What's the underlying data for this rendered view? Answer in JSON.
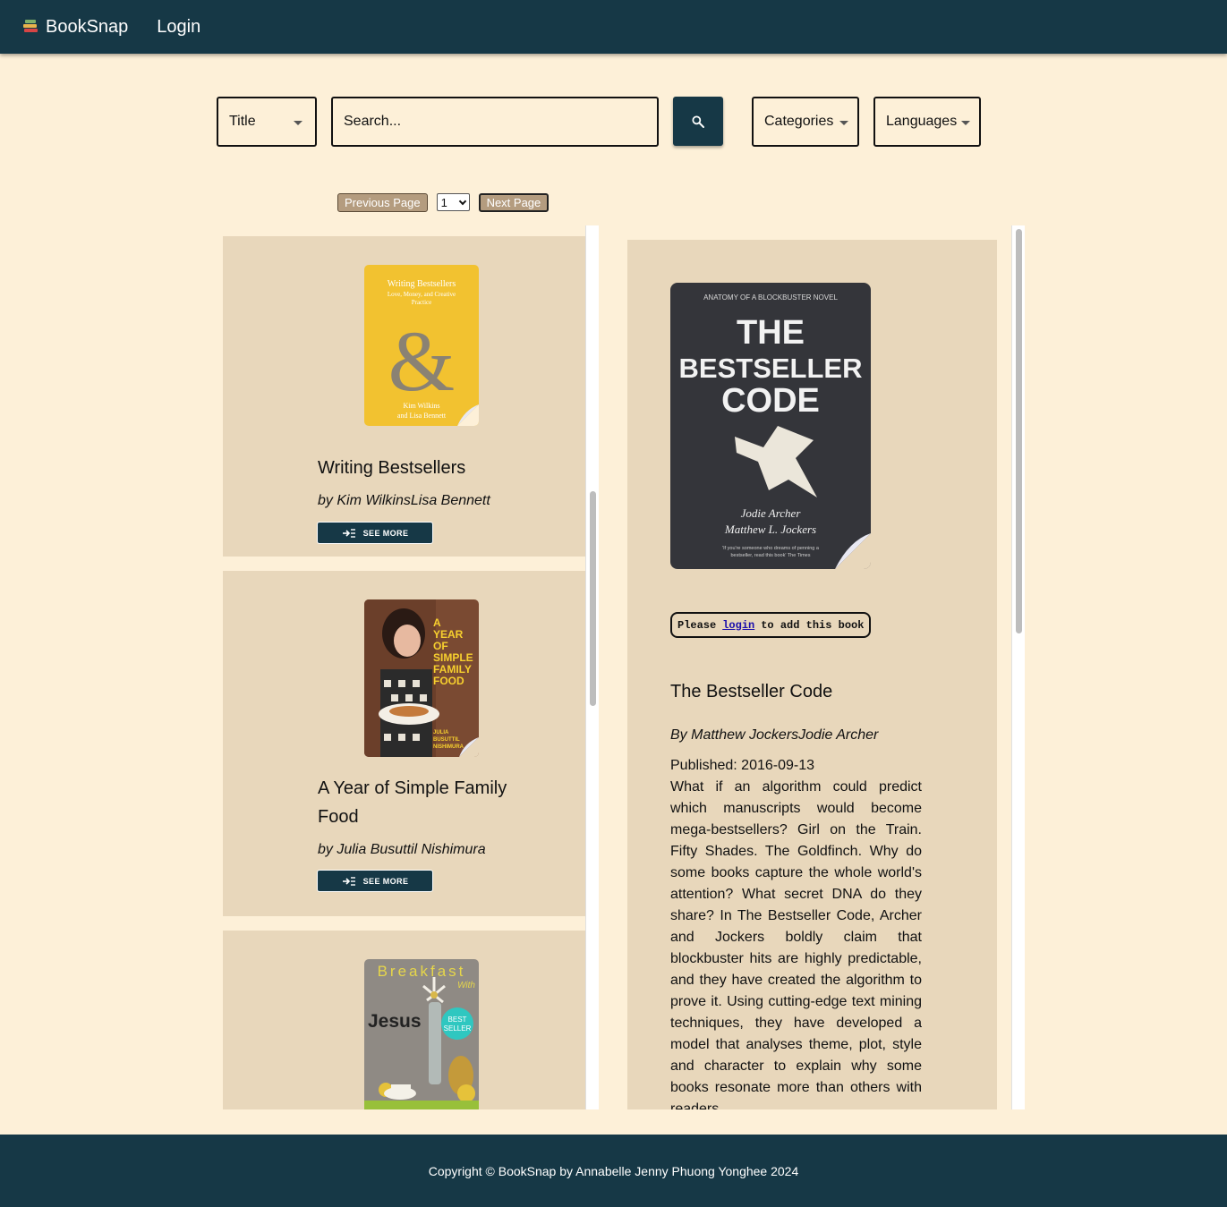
{
  "nav": {
    "brand": "BookSnap",
    "login": "Login"
  },
  "search": {
    "field_select": "Title",
    "placeholder": "Search...",
    "categories": "Categories",
    "languages": "Languages"
  },
  "pagination": {
    "previous": "Previous Page",
    "page": "1",
    "next": "Next Page"
  },
  "books": [
    {
      "title": "Writing Bestsellers",
      "author": "by Kim WilkinsLisa Bennett",
      "see_more": "SEE MORE",
      "cover": {
        "line1": "Writing Bestsellers",
        "line2": "Love, Money, and Creative",
        "line3": "Practice",
        "glyph": "&",
        "author1": "Kim Wilkins",
        "author2": "and Lisa Bennett"
      }
    },
    {
      "title": "A Year of Simple Family Food",
      "author": "by Julia Busuttil Nishimura",
      "see_more": "SEE MORE",
      "cover": {
        "l1": "A",
        "l2": "YEAR",
        "l3": "OF",
        "l4": "SIMPLE",
        "l5": "FAMILY",
        "l6": "FOOD",
        "a1": "JULIA",
        "a2": "BUSUTTIL",
        "a3": "NISHIMURA"
      }
    },
    {
      "title": "Breakfast With Jesus",
      "cover": {
        "top": "Breakfast",
        "with": "With",
        "name": "Jesus",
        "badge1": "BEST",
        "badge2": "SELLER"
      }
    }
  ],
  "detail": {
    "title": "The Bestseller Code",
    "author": "By Matthew JockersJodie Archer",
    "published": "Published: 2016-09-13",
    "login_prefix": "Please",
    "login_link": "login",
    "login_suffix": "to add this book",
    "description": "What if an algorithm could predict which manuscripts would become mega-bestsellers? Girl on the Train. Fifty Shades. The Goldfinch. Why do some books capture the whole world's attention? What secret DNA do they share? In The Bestseller Code, Archer and Jockers boldly claim that blockbuster hits are highly predictable, and they have created the algorithm to prove it. Using cutting-edge text mining techniques, they have developed a model that analyses theme, plot, style and character to explain why some books resonate more than others with readers.",
    "cover": {
      "top": "ANATOMY OF A BLOCKBUSTER NOVEL",
      "t1": "THE",
      "t2": "BESTSELLER",
      "t3": "CODE",
      "a1": "Jodie Archer",
      "a2": "Matthew L. Jockers",
      "quote1": "'If you're someone who dreams of penning a",
      "quote2": "bestseller, read this book' The Times"
    }
  },
  "footer": "Copyright © BookSnap by Annabelle Jenny Phuong Yonghee 2024",
  "colors": {
    "header": "#163846",
    "background": "#fdf0d8",
    "card": "#e8d7bb",
    "page_button": "#b49c7f"
  },
  "icons": [
    "books-icon",
    "search-icon",
    "caret-down-icon",
    "see-more-icon"
  ]
}
